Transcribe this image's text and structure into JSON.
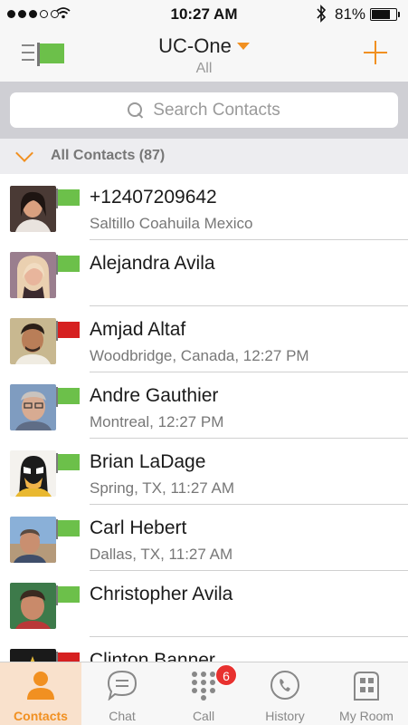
{
  "status_bar": {
    "time": "10:27 AM",
    "battery_percent": "81%",
    "battery_level": 0.81
  },
  "navbar": {
    "title": "UC-One",
    "subtitle": "All"
  },
  "search": {
    "placeholder": "Search Contacts"
  },
  "group": {
    "label": "All Contacts (87)"
  },
  "contacts": [
    {
      "name": "+12407209642",
      "detail": "Saltillo Coahuila Mexico",
      "presence": "available"
    },
    {
      "name": "Alejandra Avila",
      "detail": "",
      "presence": "available"
    },
    {
      "name": "Amjad Altaf",
      "detail": "Woodbridge, Canada, 12:27 PM",
      "presence": "busy"
    },
    {
      "name": "Andre Gauthier",
      "detail": "Montreal, 12:27 PM",
      "presence": "available"
    },
    {
      "name": "Brian LaDage",
      "detail": "Spring, TX, 11:27 AM",
      "presence": "available"
    },
    {
      "name": "Carl Hebert",
      "detail": "Dallas, TX, 11:27 AM",
      "presence": "available"
    },
    {
      "name": "Christopher Avila",
      "detail": "",
      "presence": "available"
    },
    {
      "name": "Clinton Banner",
      "detail": "",
      "presence": "busy"
    }
  ],
  "tabs": [
    {
      "label": "Contacts",
      "icon": "person-icon",
      "active": true
    },
    {
      "label": "Chat",
      "icon": "chat-bubble-icon",
      "active": false
    },
    {
      "label": "Call",
      "icon": "dialpad-icon",
      "active": false,
      "badge": "6"
    },
    {
      "label": "History",
      "icon": "clock-phone-icon",
      "active": false
    },
    {
      "label": "My Room",
      "icon": "building-icon",
      "active": false
    }
  ],
  "colors": {
    "accent": "#f19021",
    "presence_available": "#6cc04a",
    "presence_busy": "#d62020",
    "badge": "#e8312f"
  }
}
